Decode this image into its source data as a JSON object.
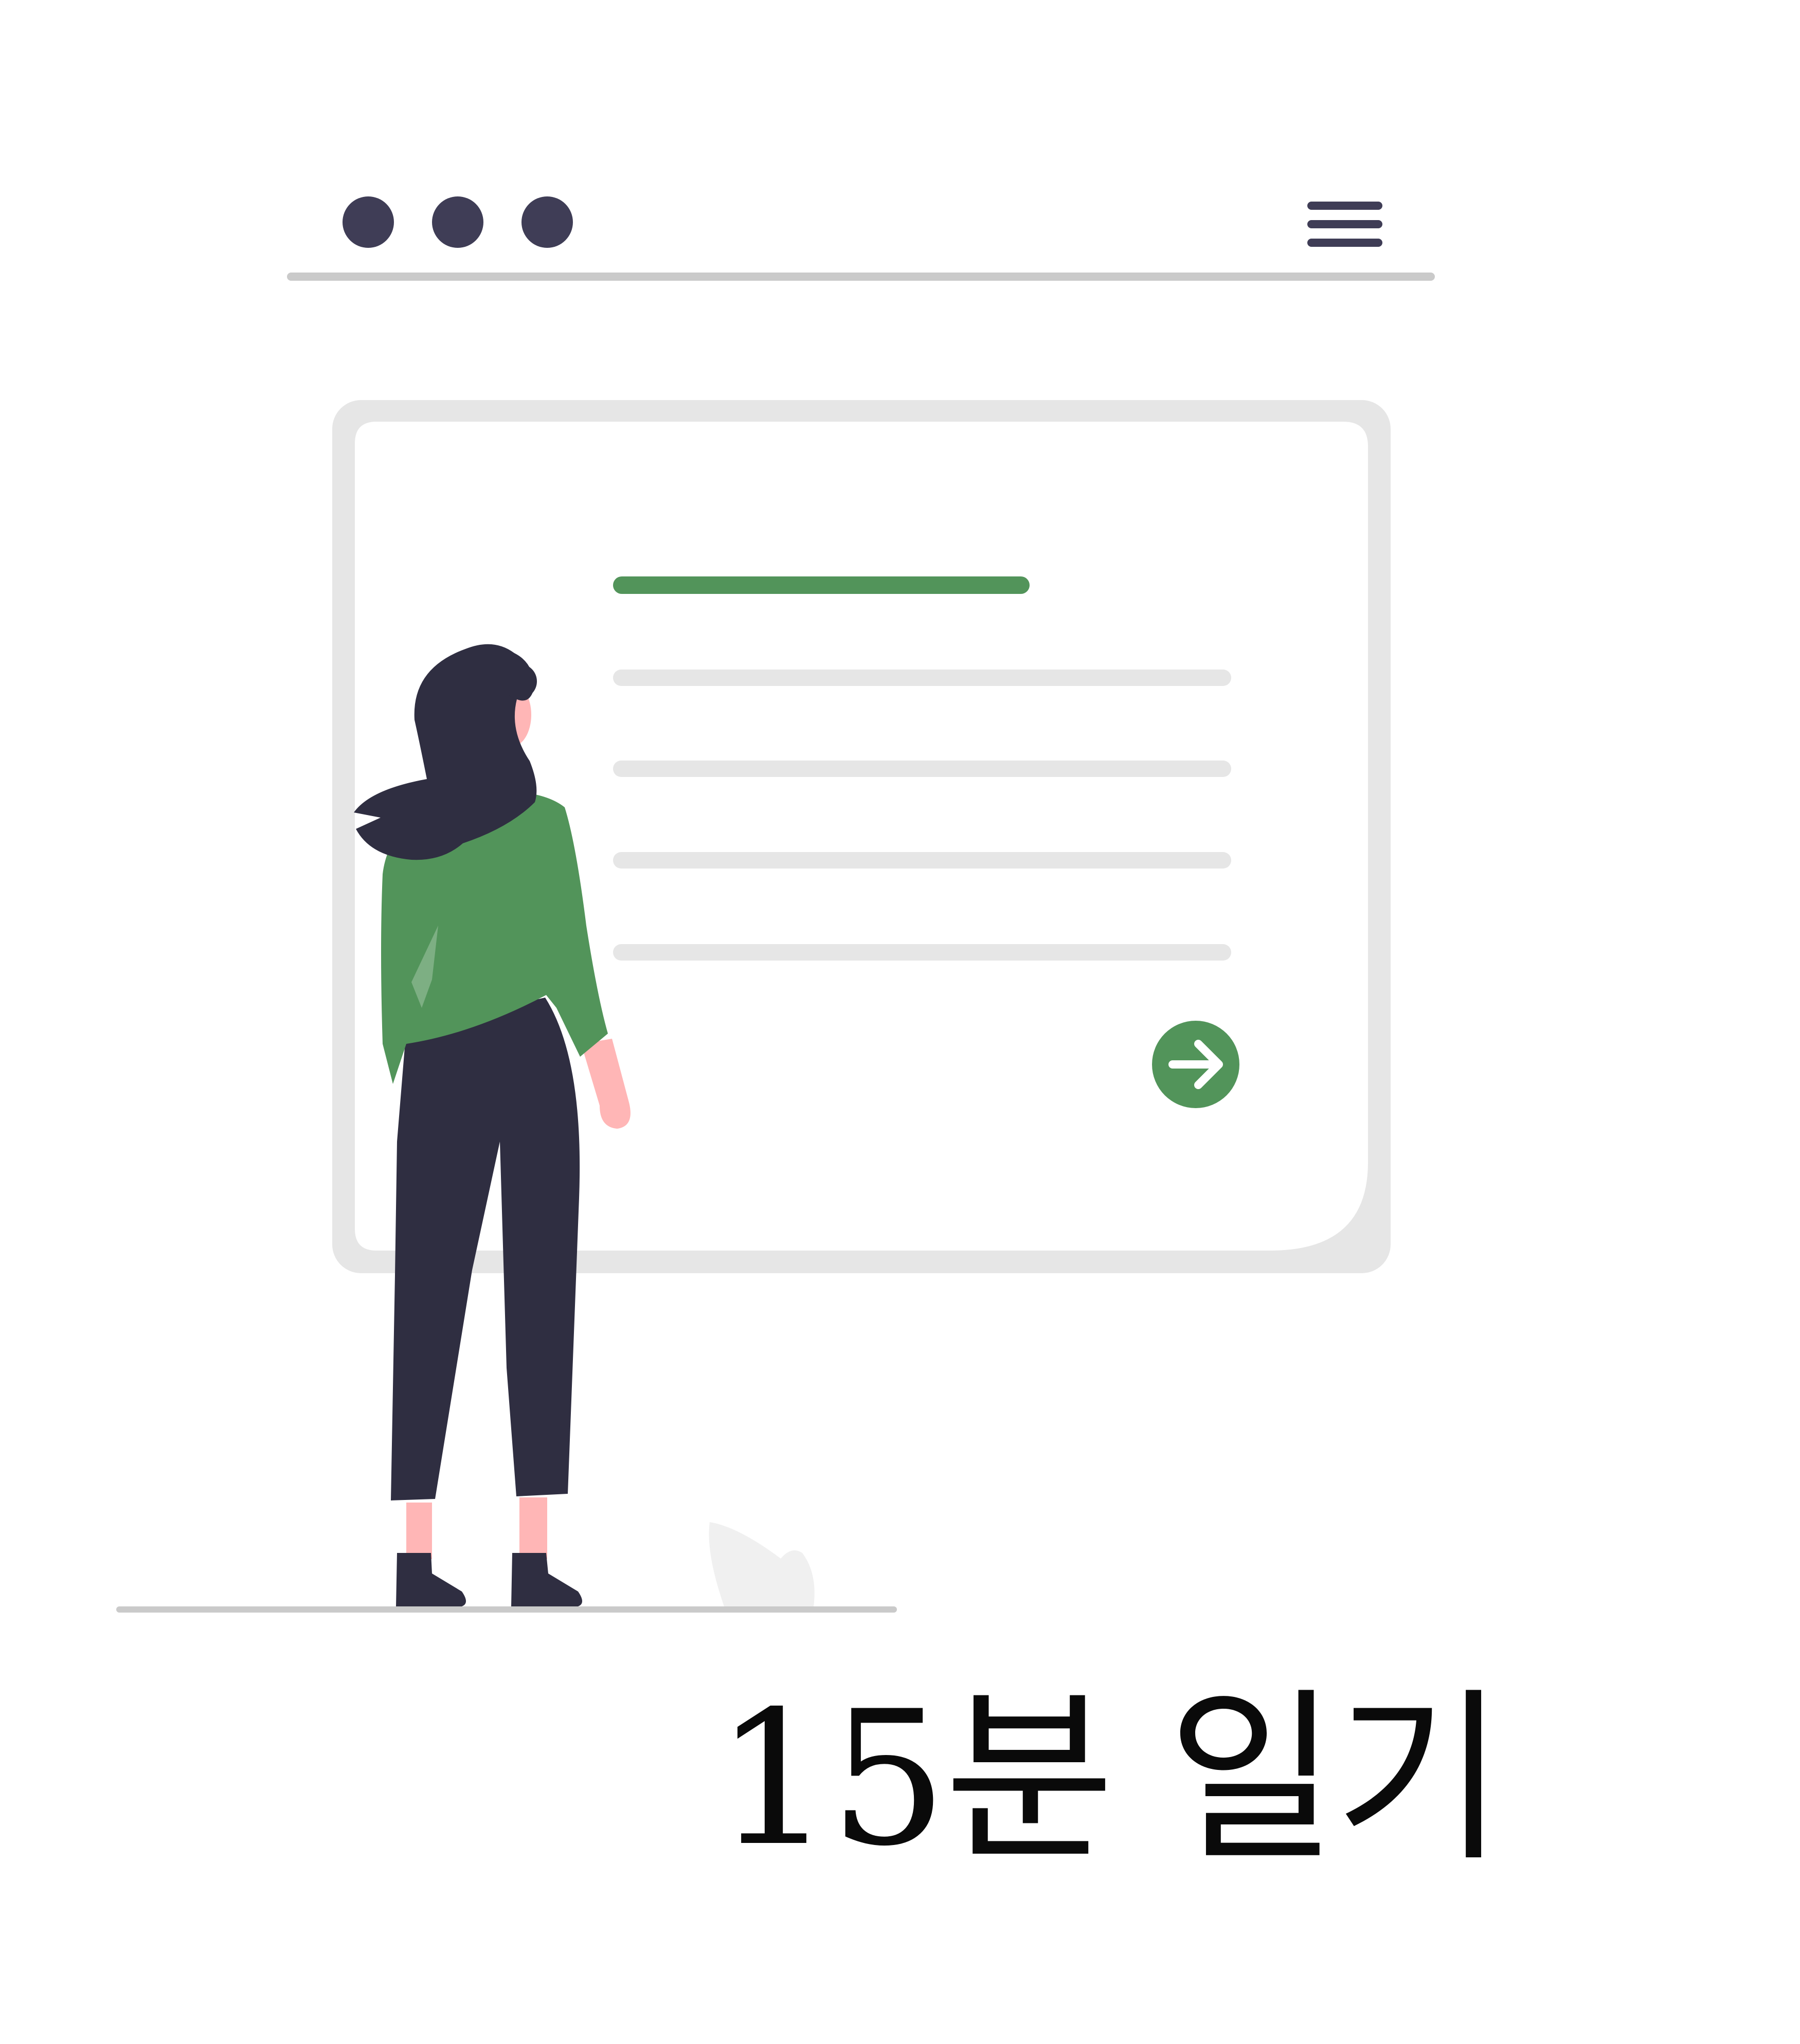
{
  "caption": {
    "text": "15분 일기"
  },
  "colors": {
    "accent_green": "#52945a",
    "dark": "#2f2e41",
    "window_dots": "#3f3d56",
    "placeholder_line": "#e6e6e6",
    "card_border": "#e6e6e6",
    "skin": "#ffb6b6",
    "ground": "#cacaca"
  },
  "icons": {
    "window_dots": "three-dots-icon",
    "menu": "hamburger-menu-icon",
    "next": "arrow-right-icon"
  }
}
